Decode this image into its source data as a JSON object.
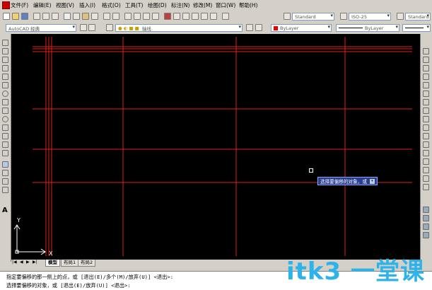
{
  "menu": [
    "文件(F)",
    "编辑(E)",
    "视图(V)",
    "插入(I)",
    "格式(O)",
    "工具(T)",
    "绘图(D)",
    "标注(N)",
    "修改(M)",
    "窗口(W)",
    "帮助(H)"
  ],
  "toolbar1": {
    "text_style": "Standard",
    "dim_style": "ISO-25",
    "table_style": "Standard"
  },
  "toolbar2": {
    "workspace": "AutoCAD 经典",
    "layer": "轴线",
    "color": "ByLayer",
    "linetype": "ByLayer"
  },
  "tabs": [
    "模型",
    "布局1",
    "布局2"
  ],
  "cmd": {
    "line1": "指定要偏移的那一侧上的点，或 [退出(E)/多个(M)/放弃(U)] <退出>:",
    "line2": "选择要偏移的对象，或 [退出(E)/放弃(U)] <退出>:"
  },
  "tooltip": "选择要偏移的对象，或",
  "ucs": {
    "x_label": "X",
    "y_label": "Y"
  },
  "watermark": "itk3 一堂课",
  "colors": {
    "canvas": "#000000",
    "lines": "#e0201c",
    "chrome": "#d4d0c8"
  }
}
